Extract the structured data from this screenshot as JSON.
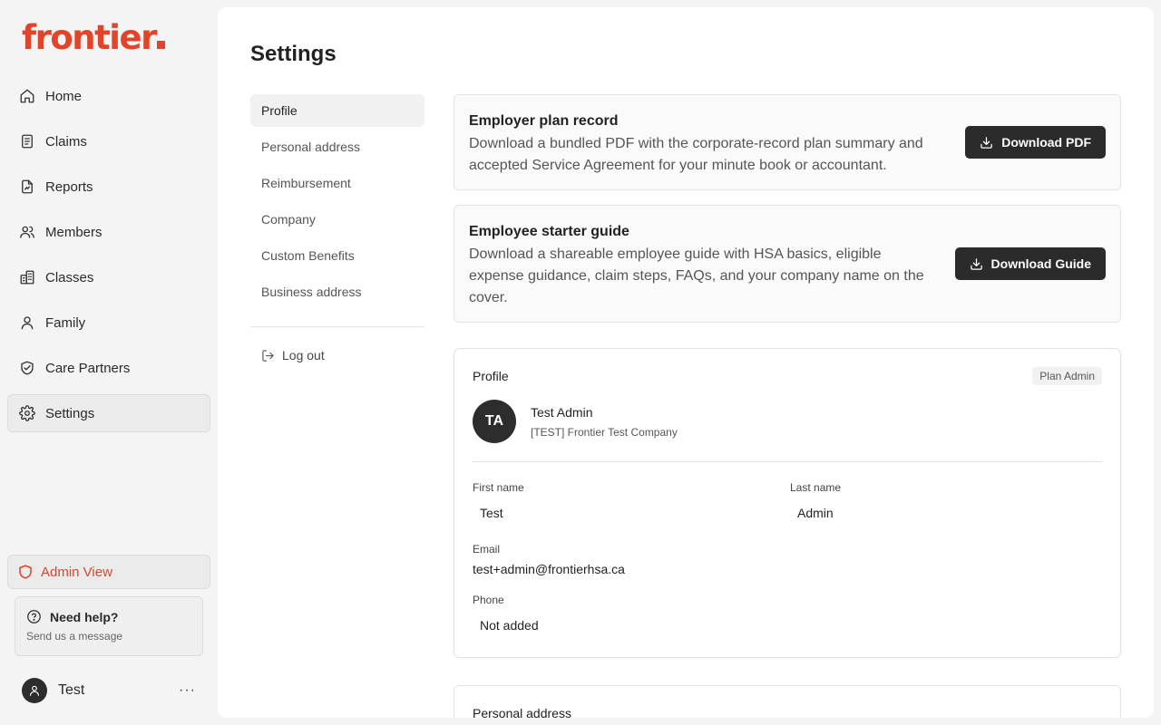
{
  "brand": {
    "name": "frontier",
    "color": "#e0442a"
  },
  "sidebar": {
    "items": [
      {
        "label": "Home",
        "icon": "home-icon"
      },
      {
        "label": "Claims",
        "icon": "document-icon"
      },
      {
        "label": "Reports",
        "icon": "report-icon"
      },
      {
        "label": "Members",
        "icon": "users-icon"
      },
      {
        "label": "Classes",
        "icon": "building-icon"
      },
      {
        "label": "Family",
        "icon": "person-icon"
      },
      {
        "label": "Care Partners",
        "icon": "handshake-shield-icon"
      },
      {
        "label": "Settings",
        "icon": "gear-icon",
        "active": true
      }
    ],
    "admin_view": "Admin View",
    "help": {
      "title": "Need help?",
      "subtitle": "Send us a message"
    },
    "user": {
      "name": "Test",
      "more": "···"
    }
  },
  "page": {
    "title": "Settings",
    "subnav": [
      {
        "label": "Profile",
        "active": true
      },
      {
        "label": "Personal address"
      },
      {
        "label": "Reimbursement"
      },
      {
        "label": "Company"
      },
      {
        "label": "Custom Benefits"
      },
      {
        "label": "Business address"
      }
    ],
    "logout": "Log out"
  },
  "cards": {
    "employer_plan": {
      "title": "Employer plan record",
      "description": "Download a bundled PDF with the corporate-record plan summary and accepted Service Agreement for your minute book or accountant.",
      "button": "Download PDF"
    },
    "starter_guide": {
      "title": "Employee starter guide",
      "description": "Download a shareable employee guide with HSA basics, eligible expense guidance, claim steps, FAQs, and your company name on the cover.",
      "button": "Download Guide"
    }
  },
  "profile": {
    "section_title": "Profile",
    "badge": "Plan Admin",
    "initials": "TA",
    "name": "Test Admin",
    "company": "[TEST] Frontier Test Company",
    "fields": {
      "first_name_label": "First name",
      "first_name": "Test",
      "last_name_label": "Last name",
      "last_name": "Admin",
      "email_label": "Email",
      "email": "test+admin@frontierhsa.ca",
      "phone_label": "Phone",
      "phone": "Not added"
    }
  },
  "personal_address": {
    "title": "Personal address"
  }
}
